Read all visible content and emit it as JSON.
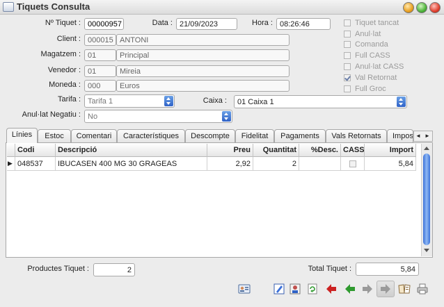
{
  "window": {
    "title": "Tiquets Consulta"
  },
  "form": {
    "ticket_label": "Nº Tiquet :",
    "ticket_value": "00000957",
    "date_label": "Data :",
    "date_value": "21/09/2023",
    "time_label": "Hora :",
    "time_value": "08:26:46",
    "client_label": "Client :",
    "client_code": "000015",
    "client_name": "ANTONI",
    "warehouse_label": "Magatzem :",
    "warehouse_code": "01",
    "warehouse_name": "Principal",
    "seller_label": "Venedor :",
    "seller_code": "01",
    "seller_name": "Mireia",
    "currency_label": "Moneda :",
    "currency_code": "000",
    "currency_name": "Euros",
    "rate_label": "Tarifa :",
    "rate_value": "Tarifa 1",
    "cashbox_label": "Caixa :",
    "cashbox_value": "01 Caixa 1",
    "negative_label": "Anul·lat Negatiu :",
    "negative_value": "No"
  },
  "checks": [
    {
      "label": "Tiquet tancat",
      "checked": false
    },
    {
      "label": "Anul·lat",
      "checked": false
    },
    {
      "label": "Comanda",
      "checked": false
    },
    {
      "label": "Full CASS",
      "checked": false
    },
    {
      "label": "Anul·lat CASS",
      "checked": false
    },
    {
      "label": "Val Retornat",
      "checked": true
    },
    {
      "label": "Full Groc",
      "checked": false
    }
  ],
  "tabs": [
    "Línies",
    "Estoc",
    "Comentari",
    "Característiques",
    "Descompte",
    "Fidelitat",
    "Pagaments",
    "Vals Retornats",
    "Impos"
  ],
  "tab_scroll": {
    "left": "◄",
    "right": "►"
  },
  "table": {
    "columns": [
      "Codi",
      "Descripció",
      "Preu",
      "Quantitat",
      "%Desc.",
      "CASS",
      "Import"
    ],
    "rows": [
      {
        "indicator": "▶",
        "code": "048537",
        "description": "IBUCASEN 400 MG 30 GRAGEAS",
        "price": "2,92",
        "qty": "2",
        "disc": "",
        "cass": false,
        "amount": "5,84"
      }
    ]
  },
  "footer": {
    "products_label": "Productes Tiquet :",
    "products_value": "2",
    "total_label": "Total Tiquet :",
    "total_value": "5,84"
  },
  "toolbar_icons": [
    "client-card-icon",
    "edit-icon",
    "person-icon",
    "refresh-icon",
    "first-icon",
    "previous-icon",
    "next-icon",
    "last-icon",
    "book-icon",
    "print-icon"
  ],
  "colors": {
    "accent": "#3a6fd8",
    "first_arrow": "#cc2222",
    "prev_arrow": "#2f9a2f"
  }
}
